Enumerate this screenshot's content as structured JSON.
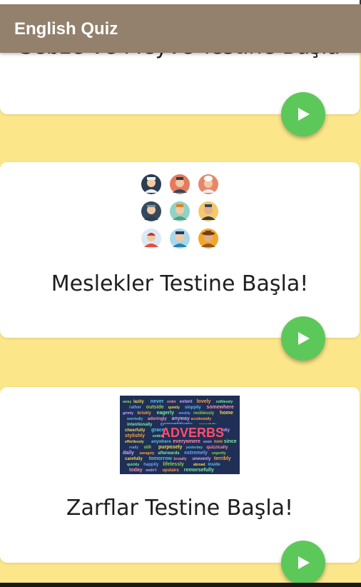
{
  "app": {
    "title": "English Quiz"
  },
  "cards": [
    {
      "label": "Sebze ve Meyve Testine Başla",
      "icon": "fruit-vegetable-image"
    },
    {
      "label": "Meslekler Testine Başla!",
      "icon": "professions-avatars-image"
    },
    {
      "label": "Zarflar Testine Başla!",
      "icon": "adverbs-word-cloud-image"
    }
  ],
  "adverbs_image": {
    "headline": "ADVERBS",
    "words": [
      "away",
      "lazily",
      "never",
      "order",
      "extent",
      "lovely",
      "ruthlessly",
      "rather",
      "outside",
      "quietly",
      "sloppily",
      "somewhere",
      "grimly",
      "briskly",
      "eagerly",
      "weekly",
      "recklessly",
      "home",
      "worriedly",
      "adoringly",
      "anyway",
      "accidentally",
      "intentionally",
      "competitively",
      "peacefully",
      "cheerfully",
      "gracefully",
      "awkwardly",
      "extravagantly",
      "stylishly",
      "underground",
      "quite",
      "beautifully",
      "effortlessly",
      "anywhere",
      "everywhere",
      "soon",
      "now",
      "since",
      "really",
      "still",
      "purposely",
      "yesterday",
      "quizzically",
      "daily",
      "savagely",
      "afterwards",
      "extremely",
      "urgently",
      "carefully",
      "tomorrow",
      "brutally",
      "unevenly",
      "terribly",
      "quickly",
      "happily",
      "lifelessly",
      "abroad",
      "inside",
      "today",
      "not/n't",
      "upstairs",
      "remorsefully"
    ]
  },
  "colors": {
    "accent": "#5dc85a",
    "appbar": "#93806d",
    "background": "#fce68a"
  }
}
